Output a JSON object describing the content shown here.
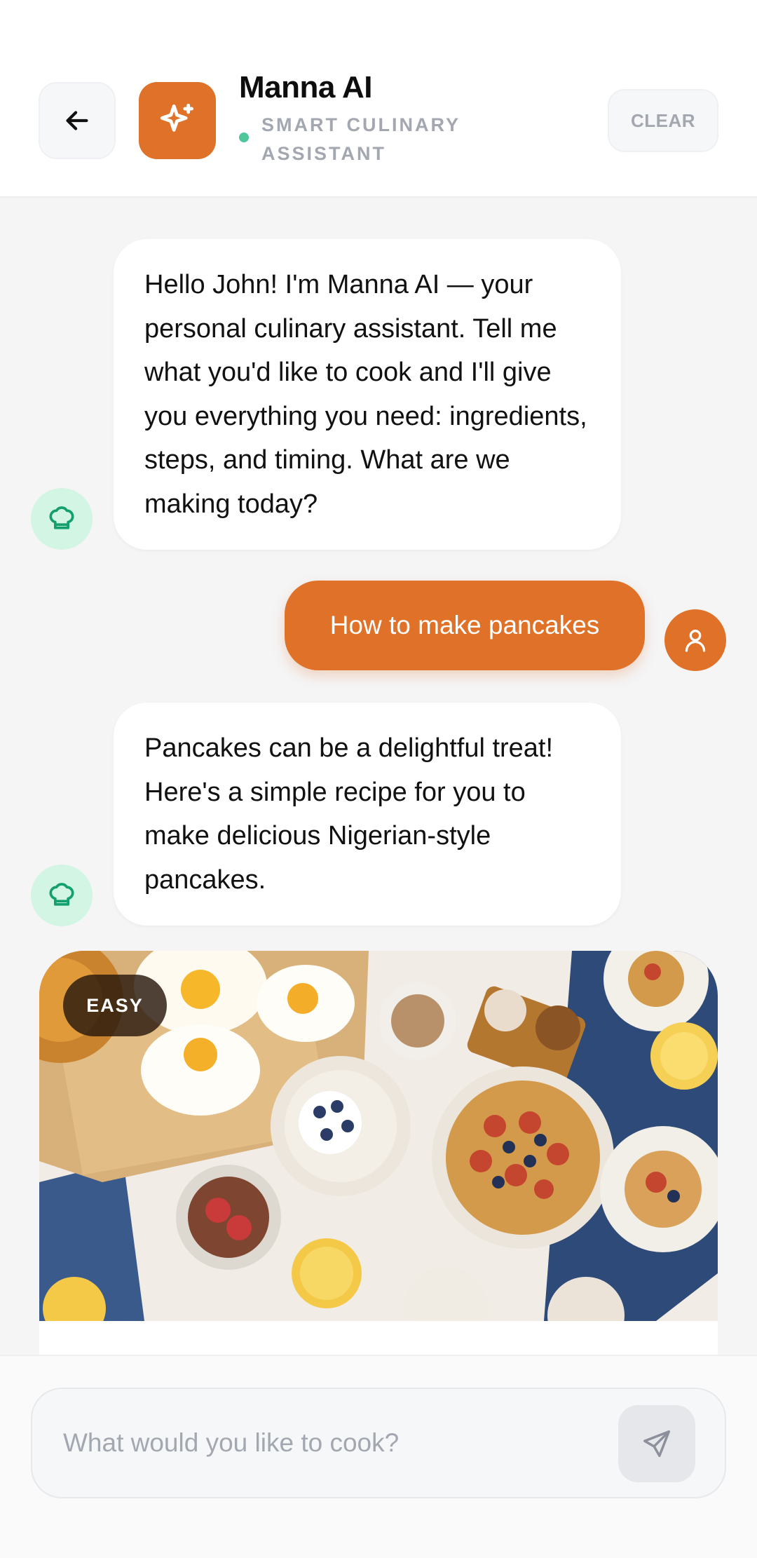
{
  "header": {
    "title": "Manna AI",
    "subtitle": "SMART CULINARY ASSISTANT",
    "clear_label": "CLEAR",
    "back_icon": "arrow-left-icon",
    "logo_icon": "sparkles-icon",
    "status": "online"
  },
  "messages": [
    {
      "role": "assistant",
      "avatar_icon": "chef-hat-icon",
      "text": "Hello John! I'm Manna AI — your personal culinary assistant. Tell me what you'd like to cook and I'll give you everything you need: ingredients, steps, and timing. What are we making today?"
    },
    {
      "role": "user",
      "avatar_icon": "user-icon",
      "text": "How to make pancakes"
    },
    {
      "role": "assistant",
      "avatar_icon": "chef-hat-icon",
      "text": "Pancakes can be a delightful treat! Here's a simple recipe for you to make delicious Nigerian-style pancakes."
    }
  ],
  "recipe_card": {
    "difficulty": "EASY"
  },
  "composer": {
    "placeholder": "What would you like to cook?",
    "send_icon": "send-icon"
  },
  "colors": {
    "accent": "#e07128",
    "online": "#4fc79a",
    "bot_avatar_bg": "#d2f5e4"
  }
}
